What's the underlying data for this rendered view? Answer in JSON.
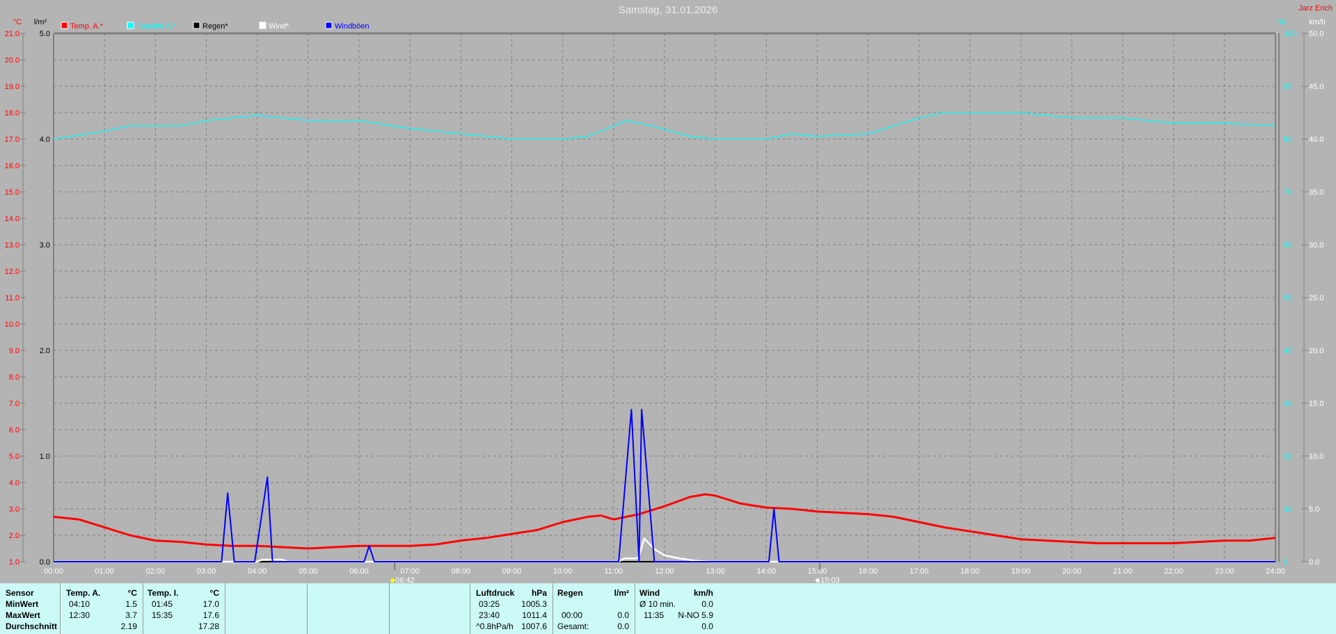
{
  "title": "Samstag, 31.01.2026",
  "owner": "Jarz Erich",
  "colors": {
    "temp": "#ff0000",
    "humidity": "#00ffff",
    "rain": "#000000",
    "wind": "#ffffff",
    "gust": "#0000ff",
    "background": "#b4b4b4",
    "table": "#ccfaf6"
  },
  "chart_data": {
    "type": "line",
    "title": "Samstag, 31.01.2026",
    "grid": true,
    "legend_placement": "top-left",
    "legend": [
      {
        "label": "Temp. A.*",
        "color": "#ff0000"
      },
      {
        "label": "Feuchte A.*",
        "color": "#00ffff"
      },
      {
        "label": "Regen*",
        "color": "#000000"
      },
      {
        "label": "Wind*",
        "color": "#ffffff"
      },
      {
        "label": "Windböen",
        "color": "#0000ff"
      }
    ],
    "x_ticks": [
      "00:00",
      "01:00",
      "02:00",
      "03:00",
      "04:00",
      "05:00",
      "06:00",
      "07:00",
      "08:00",
      "09:00",
      "10:00",
      "11:00",
      "12:00",
      "13:00",
      "14:00",
      "15:00",
      "16:00",
      "17:00",
      "18:00",
      "19:00",
      "20:00",
      "21:00",
      "22:00",
      "23:00",
      "24:00"
    ],
    "xlim_hours": [
      0,
      24
    ],
    "axes": {
      "temp": {
        "unit": "°C",
        "ylim": [
          1.0,
          21.0
        ],
        "ticks": [
          "21.0",
          "20.0",
          "19.0",
          "18.0",
          "17.0",
          "16.0",
          "15.0",
          "14.0",
          "13.0",
          "12.0",
          "11.0",
          "10.0",
          "9.0",
          "8.0",
          "7.0",
          "6.0",
          "5.0",
          "4.0",
          "3.0",
          "2.0",
          "1.0"
        ]
      },
      "rain": {
        "unit": "l/m²",
        "ylim": [
          0.0,
          5.0
        ],
        "ticks": [
          "5.0",
          "4.0",
          "3.0",
          "2.0",
          "1.0",
          "0.0"
        ]
      },
      "humidity": {
        "unit": "%",
        "ylim": [
          0,
          100
        ],
        "ticks": [
          "100",
          "90",
          "80",
          "70",
          "60",
          "50",
          "40",
          "30",
          "20",
          "10",
          "0"
        ]
      },
      "wind": {
        "unit": "km/h",
        "ylim": [
          0,
          50
        ],
        "ticks": [
          "50.0",
          "45.0",
          "40.0",
          "35.0",
          "30.0",
          "25.0",
          "20.0",
          "15.0",
          "10.0",
          "5.0",
          "0.0"
        ]
      }
    },
    "markers": [
      {
        "label": "06:42",
        "hour": 6.7,
        "kind": "sunrise"
      },
      {
        "label": "15:03",
        "hour": 15.05,
        "kind": "sunset"
      }
    ],
    "series": [
      {
        "name": "Temp. A.*",
        "axis": "temp",
        "x": [
          0,
          0.5,
          1,
          1.5,
          2,
          2.5,
          3,
          3.5,
          4,
          4.5,
          5,
          5.5,
          6,
          6.5,
          7,
          7.5,
          8,
          8.5,
          9,
          9.5,
          10,
          10.5,
          10.75,
          11,
          11.5,
          12,
          12.5,
          12.8,
          13,
          13.5,
          14,
          14.5,
          15,
          15.5,
          16,
          16.5,
          17,
          17.5,
          18,
          18.5,
          19,
          19.5,
          20,
          20.5,
          21,
          21.5,
          22,
          22.5,
          23,
          23.5,
          24
        ],
        "y": [
          2.7,
          2.6,
          2.3,
          2.0,
          1.8,
          1.75,
          1.65,
          1.6,
          1.6,
          1.55,
          1.5,
          1.55,
          1.6,
          1.6,
          1.6,
          1.65,
          1.8,
          1.9,
          2.05,
          2.2,
          2.5,
          2.7,
          2.75,
          2.6,
          2.8,
          3.1,
          3.45,
          3.55,
          3.5,
          3.2,
          3.05,
          3.0,
          2.9,
          2.85,
          2.8,
          2.7,
          2.5,
          2.3,
          2.15,
          2.0,
          1.85,
          1.8,
          1.75,
          1.7,
          1.7,
          1.7,
          1.7,
          1.75,
          1.8,
          1.8,
          1.9
        ]
      },
      {
        "name": "Feuchte A.*",
        "axis": "humidity",
        "x": [
          0,
          1,
          1.5,
          2.5,
          3,
          4,
          4.5,
          5,
          6,
          7,
          8,
          9,
          10,
          10.5,
          11.25,
          11.75,
          12.5,
          13,
          14,
          14.5,
          15,
          16,
          17,
          17.5,
          19,
          20,
          21,
          22,
          23,
          24
        ],
        "y": [
          80,
          81.5,
          82.5,
          82.5,
          83.5,
          84.5,
          84,
          83.5,
          83.5,
          82,
          81,
          80,
          80,
          80.5,
          83.5,
          82.5,
          80.5,
          80,
          80,
          81,
          80.5,
          81,
          84,
          85,
          85,
          84,
          84,
          83,
          83,
          82.5
        ]
      },
      {
        "name": "Regen*",
        "axis": "rain",
        "x": [
          0,
          24
        ],
        "y": [
          0,
          0
        ]
      },
      {
        "name": "Wind*",
        "axis": "wind",
        "x": [
          0,
          4.0,
          4.1,
          4.5,
          4.6,
          11.1,
          11.2,
          11.45,
          11.5,
          11.6,
          11.8,
          12.0,
          12.3,
          12.6,
          12.9,
          24
        ],
        "y": [
          0,
          0,
          0.2,
          0.2,
          0,
          0,
          0.3,
          0.3,
          0.5,
          2.2,
          1.2,
          0.6,
          0.3,
          0.1,
          0,
          0
        ]
      },
      {
        "name": "Windböen",
        "axis": "wind",
        "x": [
          0,
          3.3,
          3.42,
          3.55,
          3.95,
          4.2,
          4.3,
          6.1,
          6.2,
          6.3,
          11.1,
          11.35,
          11.5,
          11.55,
          11.8,
          14.05,
          14.15,
          14.25,
          24
        ],
        "y": [
          0,
          0,
          6.5,
          0,
          0,
          8.0,
          0,
          0,
          1.5,
          0,
          0,
          14.4,
          0,
          14.4,
          0,
          0,
          5.0,
          0,
          0
        ]
      }
    ]
  },
  "table": {
    "sensor": {
      "header": "Sensor",
      "rows": [
        "MinWert",
        "MaxWert",
        "Durchschnitt"
      ]
    },
    "temp_a": {
      "header": "Temp. A.",
      "unit": "°C",
      "min_time": "04:10",
      "min": "1.5",
      "max_time": "12:30",
      "max": "3.7",
      "avg": "2.19"
    },
    "temp_i": {
      "header": "Temp. I.",
      "unit": "°C",
      "min_time": "01:45",
      "min": "17.0",
      "max_time": "15:35",
      "max": "17.6",
      "avg": "17.28"
    },
    "pressure": {
      "header": "Luftdruck",
      "unit": "hPa",
      "min_time": "03:25",
      "min": "1005.3",
      "max_time": "23:40",
      "max": "1011.4",
      "trend": "^0.8hPa/h",
      "avg": "1007.6"
    },
    "rain": {
      "header": "Regen",
      "unit": "l/m²",
      "max_time": "00:00",
      "max": "0.0",
      "total_label": "Gesamt:",
      "total": "0.0"
    },
    "wind": {
      "header": "Wind",
      "unit": "km/h",
      "avg_label": "Ø 10 min.",
      "avg": "0.0",
      "max_time": "11:35",
      "max": "N-NO 5.9",
      "day_avg": "0.0"
    }
  }
}
